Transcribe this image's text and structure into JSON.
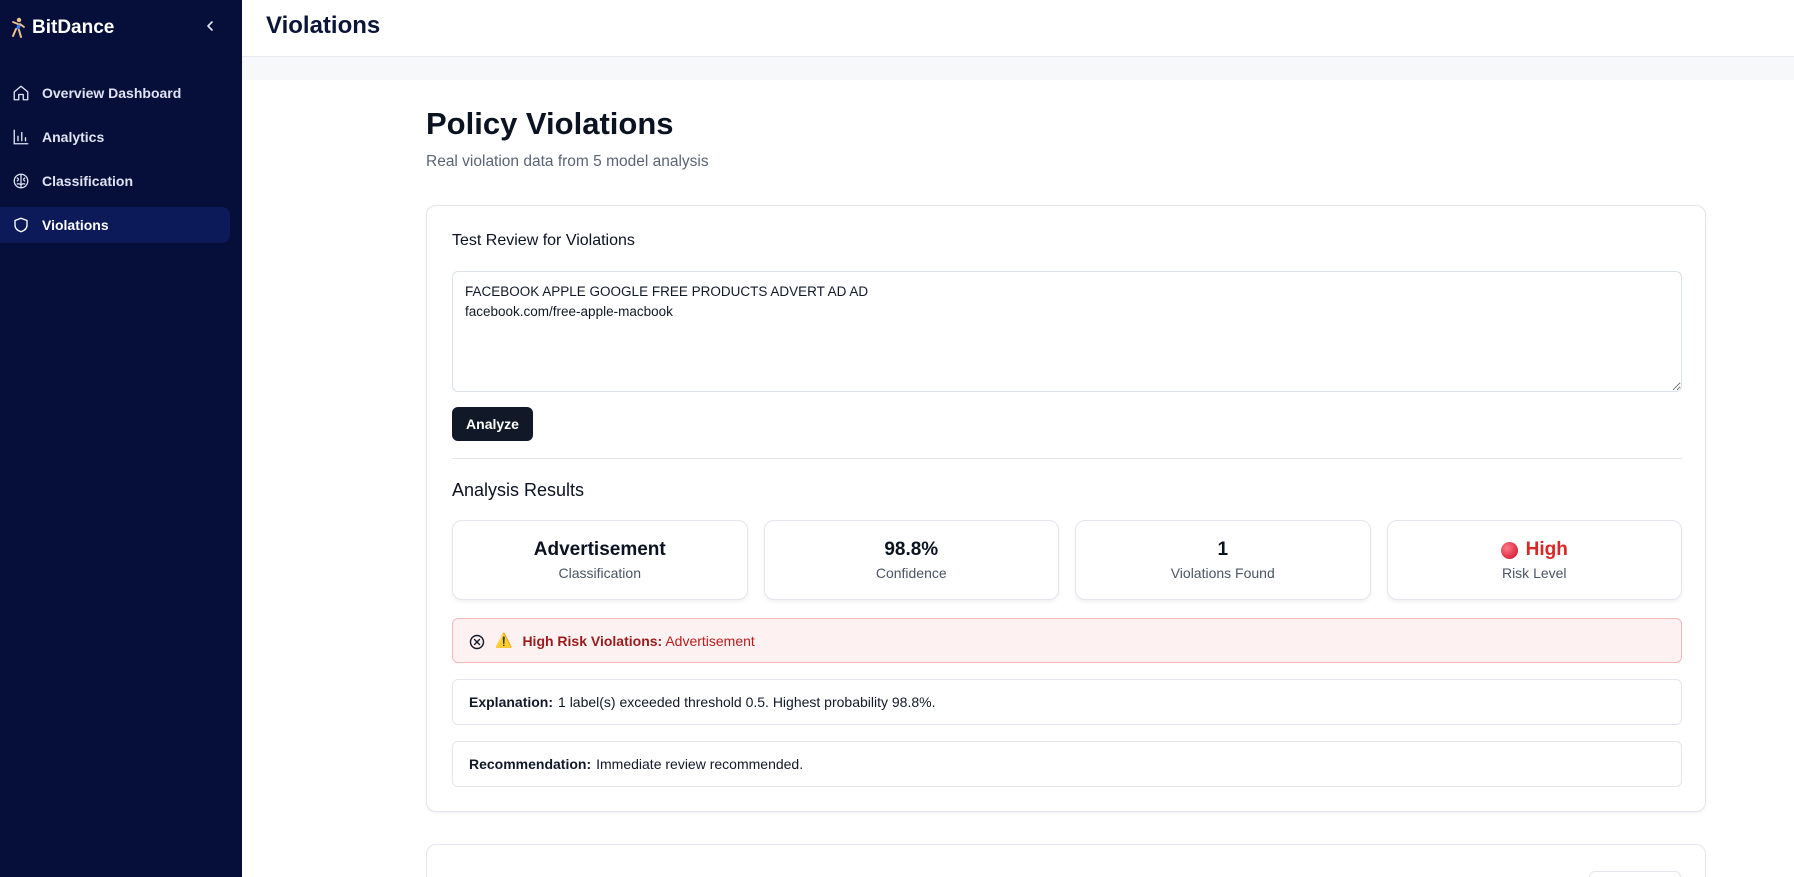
{
  "sidebar": {
    "brand": "BitDance",
    "items": [
      {
        "label": "Overview Dashboard",
        "icon": "home-icon",
        "active": false
      },
      {
        "label": "Analytics",
        "icon": "bar-chart-icon",
        "active": false
      },
      {
        "label": "Classification",
        "icon": "brain-icon",
        "active": false
      },
      {
        "label": "Violations",
        "icon": "shield-icon",
        "active": true
      }
    ]
  },
  "header": {
    "title": "Violations"
  },
  "main": {
    "title": "Policy Violations",
    "subtitle": "Real violation data from 5 model analysis",
    "test_card": {
      "title": "Test Review for Violations",
      "input_value": "FACEBOOK APPLE GOOGLE FREE PRODUCTS ADVERT AD AD\nfacebook.com/free-apple-macbook",
      "analyze_label": "Analyze"
    },
    "results": {
      "title": "Analysis Results",
      "stats": [
        {
          "value": "Advertisement",
          "label": "Classification"
        },
        {
          "value": "98.8%",
          "label": "Confidence"
        },
        {
          "value": "1",
          "label": "Violations Found"
        },
        {
          "value": "High",
          "label": "Risk Level"
        }
      ],
      "alert": {
        "icon": "⚠️",
        "label": "High Risk Violations:",
        "text": "Advertisement"
      },
      "explanation": {
        "label": "Explanation:",
        "text": "1 label(s) exceeded threshold 0.5. Highest probability 98.8%."
      },
      "recommendation": {
        "label": "Recommendation:",
        "text": "Immediate review recommended."
      }
    }
  },
  "colors": {
    "sidebar_bg": "#060f3a",
    "sidebar_active": "#0d1a5a",
    "button_bg": "#111827",
    "risk_red": "#dc2626",
    "alert_bg": "#fef1f1",
    "alert_border": "#f6b9b9"
  }
}
